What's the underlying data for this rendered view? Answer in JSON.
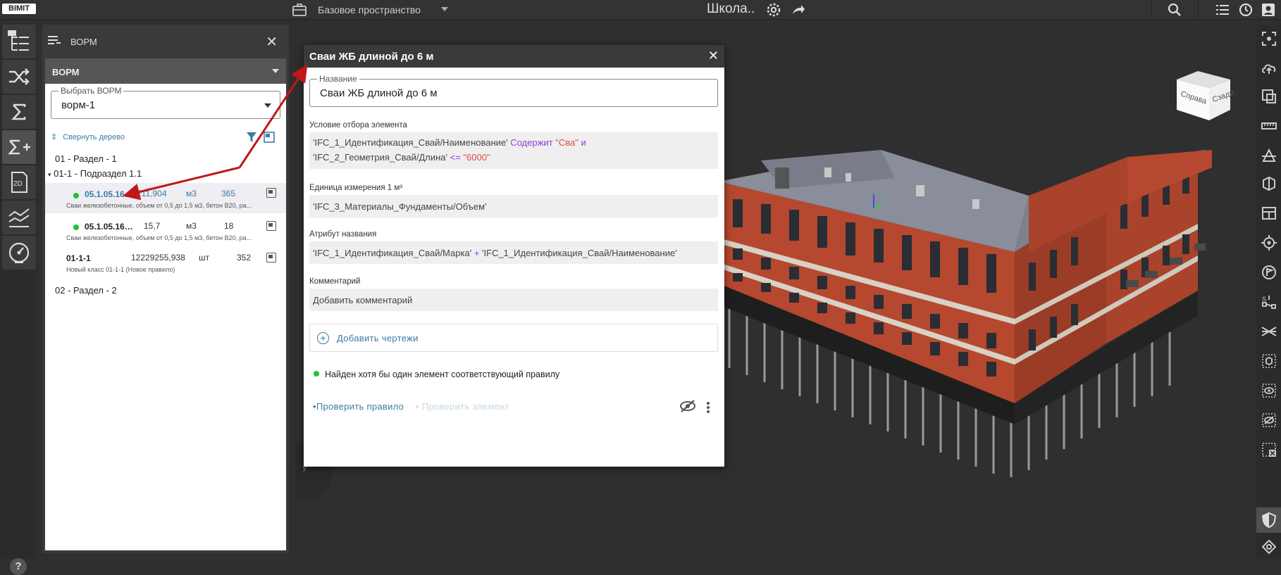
{
  "app": {
    "logo": "BIMIT",
    "workspace": "Базовое пространство",
    "project": "Школа.."
  },
  "panel": {
    "title": "ВОРМ",
    "vorm_bar": "ВОРМ",
    "select_legend": "Выбрать ВОРМ",
    "select_value": "ворм-1",
    "collapse_label": "Свернуть дерево",
    "tree": {
      "section1": "01 - Раздел - 1",
      "subsection": "01-1 - Подраздел 1.1",
      "section2": "02 - Раздел - 2"
    },
    "items": [
      {
        "code": "05.1.05.16…",
        "qty": "211,904",
        "unit": "м3",
        "count": "365",
        "desc": "Сваи железобетонные, объем от 0,5 до 1,5 м3, бетон В20, ра..."
      },
      {
        "code": "05.1.05.16…",
        "qty": "15,7",
        "unit": "м3",
        "count": "18",
        "desc": "Сваи железобетонные, объем от 0,5 до 1,5 м3, бетон В20, ра..."
      },
      {
        "code": "01-1-1",
        "qty": "12229255,938",
        "unit": "шт",
        "count": "352",
        "desc": "Новый класс 01-1-1 (Новое правило)"
      }
    ]
  },
  "dialog": {
    "title": "Сваи ЖБ длиной до 6 м",
    "name_legend": "Название",
    "name_value": "Сваи ЖБ длиной до 6 м",
    "condition_label": "Условие отбора элемента",
    "condition": {
      "part1": "'IFC_1_Идентификация_Свай/Наименование'",
      "op1": "Содержит",
      "val1": "\"Сва\"",
      "and": "и",
      "part2": "'IFC_2_Геометрия_Свай/Длина'",
      "op2": "<=",
      "val2": "\"6000\""
    },
    "unit_label": "Единица измерения 1 м³",
    "unit_value": "'IFC_3_Материалы_Фундаменты/Объем'",
    "attr_label": "Атрибут названия",
    "attr": {
      "part1": "'IFC_1_Идентификация_Свай/Марка'",
      "plus": "+",
      "part2": "'IFC_1_Идентификация_Свай/Наименование'"
    },
    "comment_label": "Комментарий",
    "comment_placeholder": "Добавить комментарий",
    "add_drawings": "Добавить чертежи",
    "found_text": "Найден хотя бы один элемент соответствующий правилу",
    "check_rule": "•Проверить правило",
    "check_element": "• Проверить элемент"
  },
  "viewcube": {
    "left": "Справа",
    "right": "Сзади"
  },
  "colors": {
    "accent": "#3a7ca5",
    "status_ok": "#22c22c",
    "arrow": "#c01818",
    "purple": "#8a3fd6",
    "red": "#e14b4b"
  }
}
